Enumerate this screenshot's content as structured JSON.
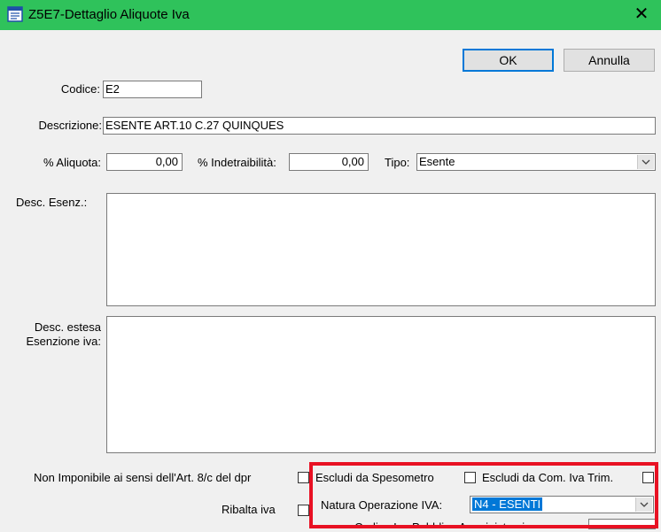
{
  "window": {
    "title": "Z5E7-Dettaglio Aliquote Iva",
    "close_glyph": "✕"
  },
  "toolbar": {
    "ok_label": "OK",
    "cancel_label": "Annulla"
  },
  "form": {
    "codice_label": "Codice:",
    "codice_value": "E2",
    "descrizione_label": "Descrizione:",
    "descrizione_value": "ESENTE ART.10 C.27 QUINQUES",
    "aliquota_label": "% Aliquota:",
    "aliquota_value": "0,00",
    "indetraibilita_label": "% Indetraibilità:",
    "indetraibilita_value": "0,00",
    "tipo_label": "Tipo:",
    "tipo_value": "Esente",
    "desc_esenz_label": "Desc. Esenz.:",
    "desc_estesa_label_1": "Desc. estesa",
    "desc_estesa_label_2": "Esenzione iva:",
    "non_imponibile_label": "Non Imponibile ai sensi dell'Art. 8/c del dpr",
    "escludi_spesometro_label": "Escludi da Spesometro",
    "escludi_com_iva_label": "Escludi da Com. Iva Trim.",
    "ribalta_iva_label": "Ribalta iva",
    "natura_label": "Natura Operazione IVA:",
    "natura_value": "N4 - ESENTI",
    "codice_pa_label": "Codice Iva Pubblica Amministrazione"
  },
  "colors": {
    "titlebar": "#2fc25b",
    "highlight_box": "#e81123",
    "selection": "#0078d7"
  }
}
